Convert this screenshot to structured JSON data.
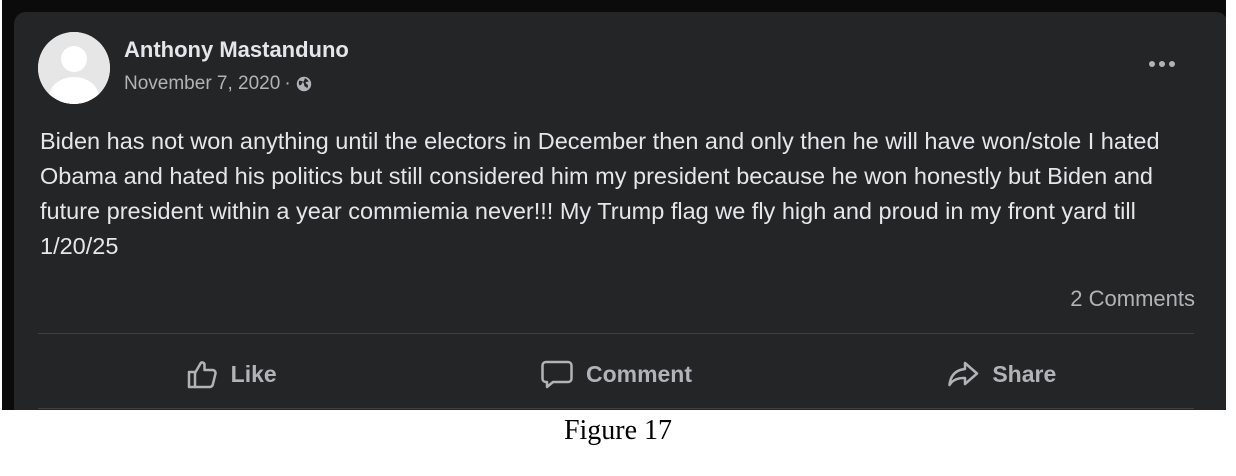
{
  "post": {
    "author_name": "Anthony Mastanduno",
    "date": "November 7, 2020",
    "separator": "·",
    "privacy_icon": "globe-icon",
    "more_icon": "more-horizontal-icon",
    "text": "Biden has not won anything until the electors in December then and only then he will have won/stole I hated Obama and hated his politics but still considered him my president because he won honestly but Biden and future president within a year commiemia never!!! My Trump flag we fly high and proud in my front yard till 1/20/25",
    "comments_count": "2 Comments"
  },
  "actions": {
    "like": {
      "label": "Like",
      "icon": "thumbs-up-icon"
    },
    "comment": {
      "label": "Comment",
      "icon": "speech-bubble-icon"
    },
    "share": {
      "label": "Share",
      "icon": "share-arrow-icon"
    }
  },
  "colors": {
    "card_background": "#242526",
    "primary_text": "#e4e6eb",
    "secondary_text": "#b0b3b8",
    "divider": "#3e4042"
  },
  "caption": "Figure 17"
}
